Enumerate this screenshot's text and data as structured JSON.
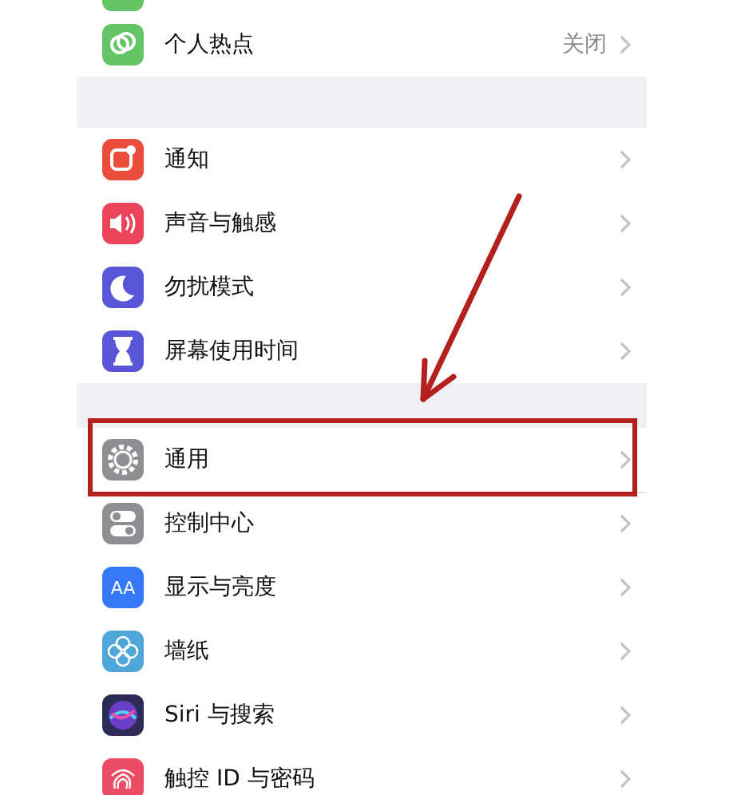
{
  "sections": [
    {
      "items": [
        {
          "label": "个人热点",
          "value": "关闭",
          "color": "#65c466",
          "highlighted": false
        }
      ]
    },
    {
      "items": [
        {
          "label": "通知",
          "color": "#eb4d3d",
          "highlighted": false
        },
        {
          "label": "声音与触感",
          "color": "#eb445a",
          "highlighted": false
        },
        {
          "label": "勿扰模式",
          "color": "#5856d6",
          "highlighted": false
        },
        {
          "label": "屏幕使用时间",
          "color": "#5856d6",
          "highlighted": false
        }
      ]
    },
    {
      "items": [
        {
          "label": "通用",
          "color": "#8e8e93",
          "highlighted": true
        },
        {
          "label": "控制中心",
          "color": "#8e8e93",
          "highlighted": false
        },
        {
          "label": "显示与亮度",
          "color": "#3478f6",
          "icon_text": "AA",
          "highlighted": false
        },
        {
          "label": "墙纸",
          "color": "#4fa6d9",
          "highlighted": false
        },
        {
          "label": "Siri 与搜索",
          "color": "#2b2b55",
          "highlighted": false
        },
        {
          "label": "触控 ID 与密码",
          "color": "#ea4c65",
          "highlighted": false
        }
      ]
    }
  ],
  "annotation_arrow": true
}
